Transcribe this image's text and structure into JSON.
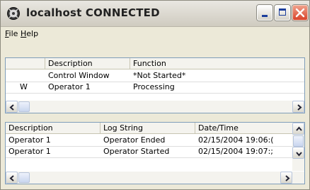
{
  "window": {
    "title": "localhost CONNECTED",
    "app_icon": "disk-icon",
    "controls": [
      "minimize-icon",
      "maximize-icon",
      "close-icon"
    ]
  },
  "menu": {
    "file": "File",
    "help": "Help"
  },
  "top_table": {
    "columns": [
      "",
      "Description",
      "Function"
    ],
    "rows": [
      {
        "status": "",
        "description": "Control Window",
        "function": "*Not Started*"
      },
      {
        "status": "W",
        "description": "Operator 1",
        "function": "Processing"
      }
    ]
  },
  "log_table": {
    "columns": [
      "Description",
      "Log String",
      "Date/Time"
    ],
    "rows": [
      {
        "description": "Operator 1",
        "log_string": "Operator Ended",
        "date_time": "02/15/2004 19:06:("
      },
      {
        "description": "Operator 1",
        "log_string": "Operator Started",
        "date_time": "02/15/2004 19:07:;"
      }
    ]
  },
  "scroll_icons": [
    "scroll-left-icon",
    "scroll-right-icon",
    "scroll-up-icon",
    "scroll-down-icon"
  ],
  "colors": {
    "close_button": "#d8432a",
    "panel_border": "#7f9db9",
    "window_bg": "#ece9d8"
  }
}
